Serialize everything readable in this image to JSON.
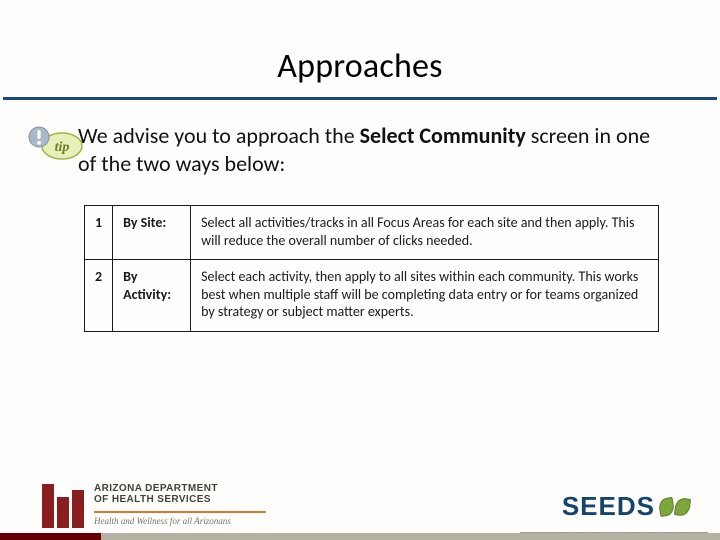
{
  "heading": "Approaches",
  "intro": {
    "prefix": "We advise you to approach the ",
    "bold": "Select Community",
    "suffix": " screen in one of the two ways below:"
  },
  "table": {
    "rows": [
      {
        "num": "1",
        "label": "By Site:",
        "desc": "Select all activities/tracks in all Focus Areas for each site and then apply. This will reduce the overall number of clicks needed."
      },
      {
        "num": "2",
        "label": "By Activity:",
        "desc": "Select each activity, then apply to all sites within each community. This works best when multiple staff will be completing data entry or for teams organized by strategy or subject matter experts."
      }
    ]
  },
  "footer": {
    "adhs": {
      "line1": "ARIZONA DEPARTMENT",
      "line2": "OF HEALTH SERVICES",
      "tagline": "Health and Wellness for all Arizonans"
    },
    "seeds": "SEEDS"
  }
}
